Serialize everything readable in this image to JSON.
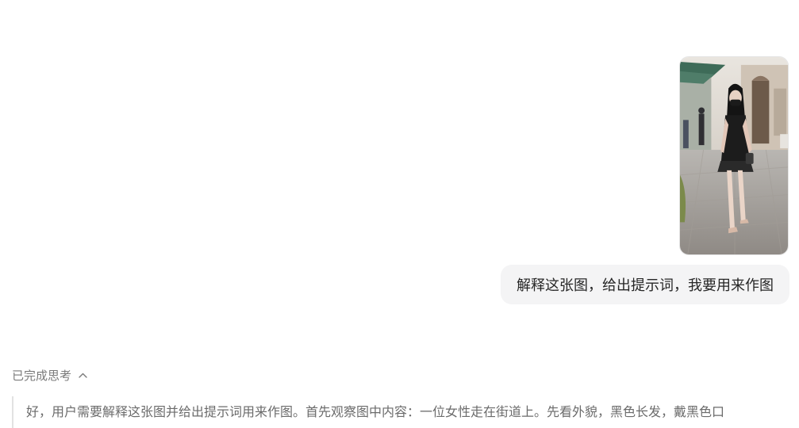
{
  "user_message": {
    "image_alt": "A woman in a black outfit walking on a paved street",
    "text": "解释这张图，给出提示词，我要用来作图"
  },
  "assistant": {
    "thinking_toggle_label": "已完成思考",
    "thinking_toggle_icon": "chevron-up-icon",
    "thinking_text": "好，用户需要解释这张图并给出提示词用来作图。首先观察图中内容：一位女性走在街道上。先看外貌，黑色长发，戴黑色口"
  }
}
